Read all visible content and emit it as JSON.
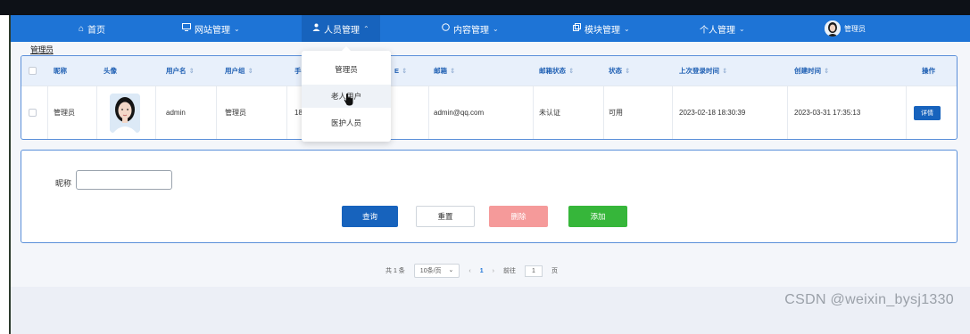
{
  "nav": {
    "items": [
      {
        "label": "首页",
        "icon": "home-icon"
      },
      {
        "label": "网站管理",
        "icon": "monitor-icon"
      },
      {
        "label": "人员管理",
        "icon": "user-icon"
      },
      {
        "label": "内容管理",
        "icon": "chat-icon"
      },
      {
        "label": "模块管理",
        "icon": "copy-icon"
      },
      {
        "label": "个人管理"
      },
      {
        "label": "管理员",
        "icon": "avatar"
      }
    ],
    "active_index": 2
  },
  "page_label": "管理员",
  "dropdown": {
    "items": [
      "管理员",
      "老人用户",
      "医护人员"
    ],
    "hover_index": 1
  },
  "table": {
    "headers": [
      "昵称",
      "头像",
      "用户名",
      "用户组",
      "手",
      "E",
      "邮箱",
      "邮箱状态",
      "状态",
      "上次登录时间",
      "创建时间",
      "操作"
    ],
    "rows": [
      {
        "nickname": "管理员",
        "username": "admin",
        "group": "管理员",
        "phone": "18",
        "email": "admin@qq.com",
        "email_status": "未认证",
        "status": "可用",
        "last_login": "2023-02-18 18:30:39",
        "created": "2023-03-31 17:35:13",
        "action": "详情"
      }
    ]
  },
  "search": {
    "label": "昵称",
    "value": "",
    "buttons": {
      "query": "查询",
      "reset": "重置",
      "delete": "删除",
      "add": "添加"
    }
  },
  "pagination": {
    "total": "共 1 条",
    "page_size": "10条/页",
    "current": "1",
    "goto_label": "前往",
    "goto_value": "1",
    "page_unit": "页"
  },
  "watermark": "CSDN @weixin_bysj1330",
  "colors": {
    "primary": "#1e74d6",
    "add": "#36b63a",
    "delete": "#f59a9a"
  }
}
